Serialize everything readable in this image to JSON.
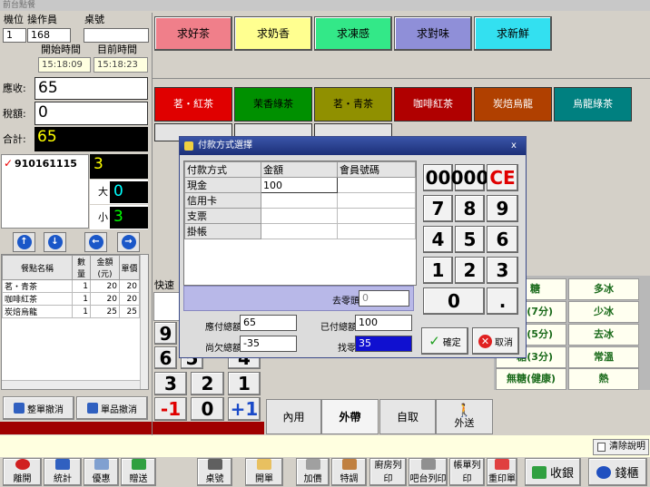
{
  "window": {
    "title": "前台點餐"
  },
  "header": {
    "seat_label": "機位",
    "operator_label": "操作員",
    "table_label": "桌號",
    "seat_value": "1",
    "operator_value": "168",
    "table_value": "",
    "start_time_label": "開始時間",
    "current_time_label": "目前時間",
    "start_time": "15:18:09",
    "current_time": "15:18:23"
  },
  "totals": {
    "receivable_label": "應收:",
    "receivable": "65",
    "tax_label": "稅額:",
    "tax": "0",
    "total_label": "合計:",
    "total": "65"
  },
  "order": {
    "order_number": "910161115",
    "count": "3",
    "large_label": "大",
    "large": "0",
    "small_label": "小",
    "small": "3"
  },
  "nav_arrows": [
    "up",
    "down",
    "left",
    "right"
  ],
  "items_table": {
    "headers": [
      "餐點名稱",
      "數量",
      "金額(元)",
      "單價"
    ],
    "rows": [
      [
        "茗・青茶",
        "1",
        "20",
        "20"
      ],
      [
        "咖啡紅茶",
        "1",
        "20",
        "20"
      ],
      [
        "炭焙烏龍",
        "1",
        "25",
        "25"
      ]
    ]
  },
  "cancel_buttons": {
    "cancel_all": "整單撤消",
    "cancel_item": "單品撤消"
  },
  "categories": [
    "求好茶",
    "求奶香",
    "求凍感",
    "求對味",
    "求新鮮"
  ],
  "category_colors": [
    "#f07f8a",
    "#ffff90",
    "#33e888",
    "#8f8fd8",
    "#33e0f0"
  ],
  "teas": [
    "茗・紅茶",
    "茉香綠茶",
    "茗・青茶",
    "咖啡紅茶",
    "炭焙烏龍",
    "烏龍綠茶"
  ],
  "tea_colors": [
    "#e00000",
    "#009000",
    "#909000",
    "#b00000",
    "#b04000",
    "#008080"
  ],
  "partial_row": [
    "",
    "",
    ""
  ],
  "quick_label": "快速",
  "quick_keys": [
    "9",
    "6",
    "5",
    "4",
    "3",
    "2",
    "1",
    "-1",
    "0",
    "+1"
  ],
  "sugar_labels": [
    "糖",
    "糖(7分)",
    "糖(5分)",
    "糖(3分)",
    "無糖(健康)"
  ],
  "ice_labels": [
    "多冰",
    "少冰",
    "去冰",
    "常溫",
    "熱"
  ],
  "service_tabs": [
    "內用",
    "外帶",
    "自取",
    "外送"
  ],
  "clear_note": "清除說明",
  "bottom_buttons": [
    "離開",
    "統計",
    "優惠",
    "贈送",
    "桌號",
    "開單",
    "加價",
    "特調",
    "廚房列印",
    "吧台列印",
    "帳單列印",
    "重印單",
    "收銀",
    "錢櫃"
  ],
  "dialog": {
    "title": "付款方式選擇",
    "close": "x",
    "headers": [
      "付款方式",
      "金額",
      "會員號碼"
    ],
    "rows": [
      [
        "現金",
        "100",
        ""
      ],
      [
        "信用卡",
        "",
        ""
      ],
      [
        "支票",
        "",
        ""
      ],
      [
        "掛帳",
        "",
        ""
      ]
    ],
    "rounding_label": "去零頭",
    "rounding_value": "0",
    "due_label": "應付總額",
    "due": "65",
    "paid_label": "已付總額",
    "paid": "100",
    "owed_label": "尚欠總額",
    "owed": "-35",
    "change_label": "找零",
    "change": "35",
    "keys": [
      "00",
      "000",
      "CE",
      "7",
      "8",
      "9",
      "4",
      "5",
      "6",
      "1",
      "2",
      "3",
      "0",
      "."
    ],
    "confirm": "確定",
    "cancel": "取消"
  }
}
